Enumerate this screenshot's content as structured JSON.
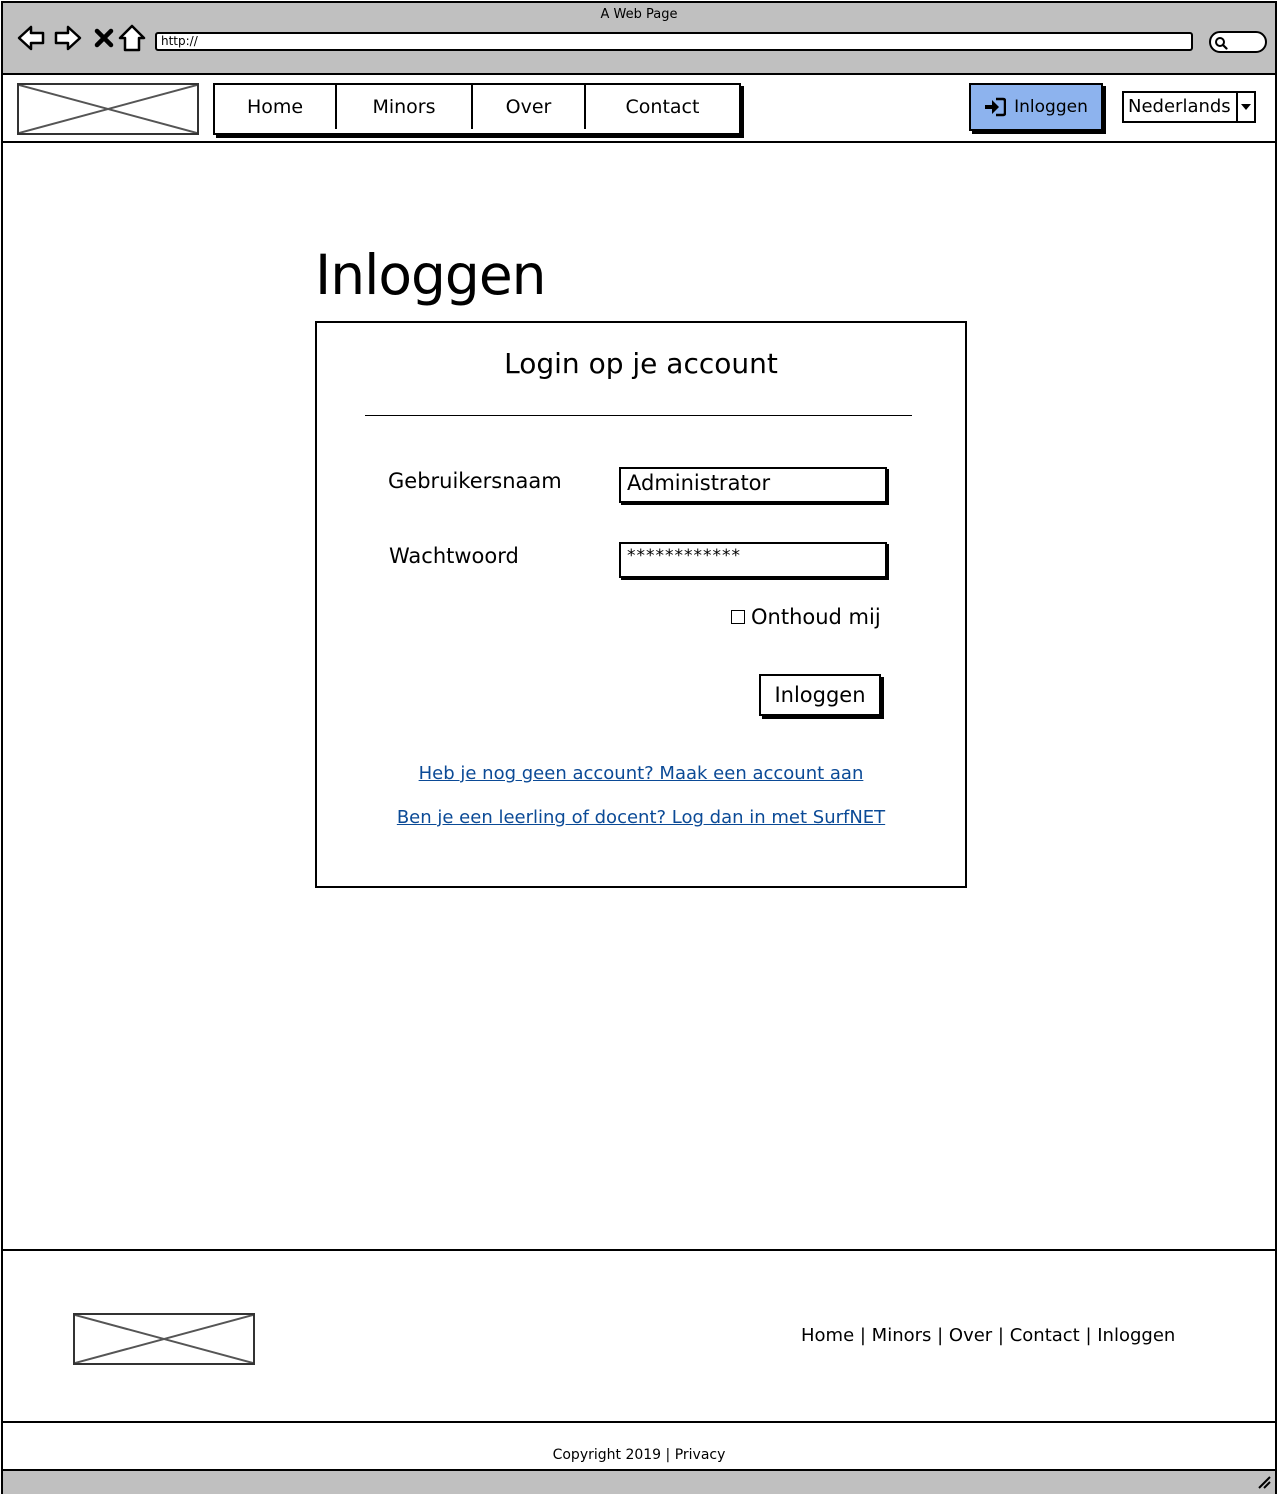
{
  "window": {
    "title": "A Web Page",
    "url": "http://"
  },
  "header": {
    "nav": [
      "Home",
      "Minors",
      "Over",
      "Contact"
    ],
    "login_button": "Inloggen",
    "language": "Nederlands"
  },
  "main": {
    "page_title": "Inloggen",
    "card_title": "Login op je account",
    "username_label": "Gebruikersnaam",
    "username_value": "Administrator",
    "password_label": "Wachtwoord",
    "password_value": "************",
    "remember_label": "Onthoud mij",
    "submit_label": "Inloggen",
    "signup_link": "Heb je nog geen account? Maak een account aan",
    "surfnet_link": "Ben je een leerling of docent? Log dan in met SurfNET"
  },
  "footer": {
    "links": "Home | Minors | Over | Contact | Inloggen",
    "copyright": "Copyright 2019 | Privacy"
  },
  "colors": {
    "accent": "#8db3ee",
    "link": "#0b4a96",
    "chrome": "#c0c0c0"
  }
}
